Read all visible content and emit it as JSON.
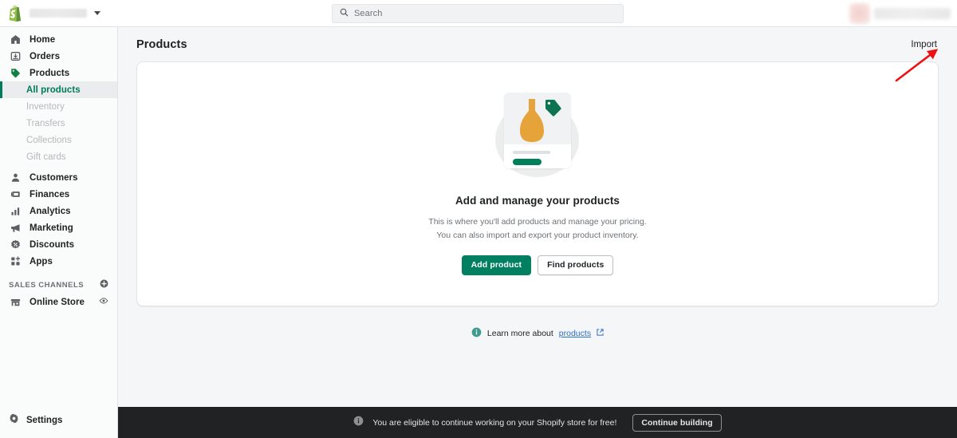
{
  "topbar": {
    "logo_icon": "shopify-bag-icon",
    "store_name_redacted": true,
    "caret_icon": "chevron-down-icon",
    "search": {
      "placeholder": "Search",
      "icon": "search-icon",
      "value": ""
    },
    "account_redacted": true
  },
  "sidebar": {
    "items": [
      {
        "label": "Home",
        "icon": "home-icon"
      },
      {
        "label": "Orders",
        "icon": "orders-inbox-icon"
      },
      {
        "label": "Products",
        "icon": "tag-icon",
        "active": true
      }
    ],
    "subitems": [
      {
        "label": "All products",
        "selected": true
      },
      {
        "label": "Inventory",
        "selected": false
      },
      {
        "label": "Transfers",
        "selected": false
      },
      {
        "label": "Collections",
        "selected": false
      },
      {
        "label": "Gift cards",
        "selected": false
      }
    ],
    "items2": [
      {
        "label": "Customers",
        "icon": "person-icon"
      },
      {
        "label": "Finances",
        "icon": "finances-icon"
      },
      {
        "label": "Analytics",
        "icon": "bar-chart-icon"
      },
      {
        "label": "Marketing",
        "icon": "megaphone-icon"
      },
      {
        "label": "Discounts",
        "icon": "discount-tag-icon"
      },
      {
        "label": "Apps",
        "icon": "apps-grid-icon"
      }
    ],
    "sales_channels": {
      "title": "SALES CHANNELS",
      "add_icon": "plus-circle-icon",
      "items": [
        {
          "label": "Online Store",
          "icon": "storefront-icon",
          "action_icon": "eye-icon"
        }
      ]
    },
    "settings": {
      "label": "Settings",
      "icon": "gear-icon"
    }
  },
  "main": {
    "page_title": "Products",
    "import_label": "Import",
    "empty_state": {
      "illustration": "product-card-vase-illustration",
      "title": "Add and manage your products",
      "description_line1": "This is where you'll add products and manage your pricing.",
      "description_line2": "You can also import and export your product inventory.",
      "primary_button": "Add product",
      "secondary_button": "Find products"
    },
    "learn_more": {
      "icon": "info-circle-icon",
      "prefix": "Learn more about",
      "link": "products",
      "external_icon": "external-link-icon"
    }
  },
  "banner": {
    "icon": "info-circle-icon",
    "text": "You are eligible to continue working on your Shopify store for free!",
    "button": "Continue building"
  },
  "annotation": {
    "type": "red-arrow",
    "color": "#ee1111",
    "points_to": "Import"
  },
  "colors": {
    "brand_green": "#008060",
    "accent_teal": "#007b5c",
    "link_blue": "#2c6ecb",
    "page_bg": "#f4f6f8",
    "banner_bg": "#202223"
  }
}
